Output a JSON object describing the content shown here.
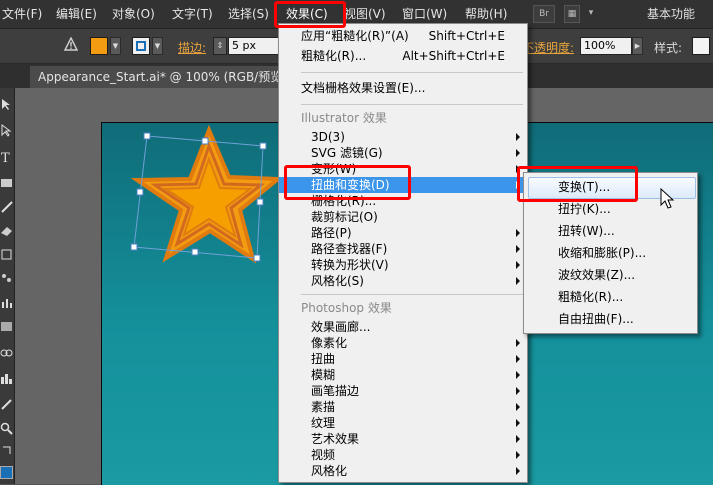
{
  "menubar": {
    "items": [
      "文件(F)",
      "编辑(E)",
      "对象(O)",
      "文字(T)",
      "选择(S)",
      "效果(C)",
      "视图(V)",
      "窗口(W)",
      "帮助(H)"
    ],
    "br_label": "Br",
    "workspace": "基本功能"
  },
  "controlbar": {
    "fill_color": "#f39c12",
    "stroke_label": "描边:",
    "stroke_value": "5 px",
    "opacity_label": "不透明度:",
    "opacity_value": "100%",
    "style_label": "样式:"
  },
  "document_tab": {
    "title": "Appearance_Start.ai* @ 100% (RGB/预览)"
  },
  "effect_menu": {
    "apply_last": {
      "label": "应用“粗糙化(R)”(A)",
      "shortcut": "Shift+Ctrl+E"
    },
    "last_effect": {
      "label": "粗糙化(R)...",
      "shortcut": "Alt+Shift+Ctrl+E"
    },
    "raster_settings": "文档栅格效果设置(E)...",
    "illustrator_header": "Illustrator 效果",
    "illustrator_items": [
      "3D(3)",
      "SVG 滤镜(G)",
      "变形(W)",
      "扭曲和变换(D)",
      "栅格化(R)...",
      "裁剪标记(O)",
      "路径(P)",
      "路径查找器(F)",
      "转换为形状(V)",
      "风格化(S)"
    ],
    "photoshop_header": "Photoshop 效果",
    "photoshop_items": [
      "效果画廊...",
      "像素化",
      "扭曲",
      "模糊",
      "画笔描边",
      "素描",
      "纹理",
      "艺术效果",
      "视频",
      "风格化"
    ]
  },
  "submenu": {
    "items": [
      "变换(T)...",
      "扭拧(K)...",
      "扭转(W)...",
      "收缩和膨胀(P)...",
      "波纹效果(Z)...",
      "粗糙化(R)...",
      "自由扭曲(F)..."
    ]
  },
  "colors": {
    "highlight": "#3b95ea",
    "callout": "#ff0000",
    "star_fill": "#f5a000",
    "star_stroke": "#e07b10"
  }
}
